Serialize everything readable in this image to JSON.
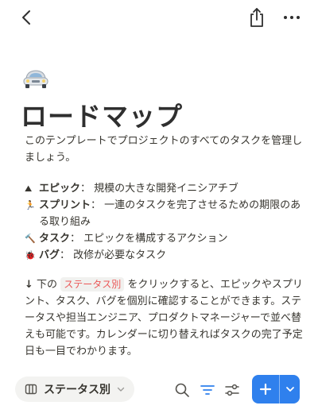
{
  "page": {
    "title": "ロードマップ",
    "icon": "car-icon",
    "intro": "このテンプレートでプロジェクトのすべてのタスクを管理しましょう。"
  },
  "definitions": [
    {
      "icon": "mountain-icon",
      "emoji": "⛰",
      "term": "エピック",
      "separator": "：",
      "text": "規模の大きな開発イニシアチブ"
    },
    {
      "icon": "runner-icon",
      "emoji": "🏃",
      "term": "スプリント",
      "separator": "：",
      "text": "一連のタスクを完了させるための期限のある取り組み"
    },
    {
      "icon": "hammer-icon",
      "emoji": "🔨",
      "term": "タスク",
      "separator": "：",
      "text": "エピックを構成するアクション"
    },
    {
      "icon": "bug-icon",
      "emoji": "🐞",
      "term": "バグ",
      "separator": "：",
      "text": "改修が必要なタスク"
    }
  ],
  "paragraph2": {
    "arrow": "↓",
    "before": "下の",
    "chip": "ステータス別",
    "after": "をクリックすると、エピックやスプリント、タスク、バグを個別に確認することができます。ステータスや担当エンジニア、プロダクトマネージャーで並べ替えも可能です。カレンダーに切り替えればタスクの完了予定日も一目でわかります。"
  },
  "bottom_bar": {
    "view_label": "ステータス別",
    "new_button": "+"
  },
  "colors": {
    "accent": "#2f80ed",
    "chip_text": "#eb5757",
    "chip_bg": "#f1f1ef",
    "text": "#37352f"
  }
}
